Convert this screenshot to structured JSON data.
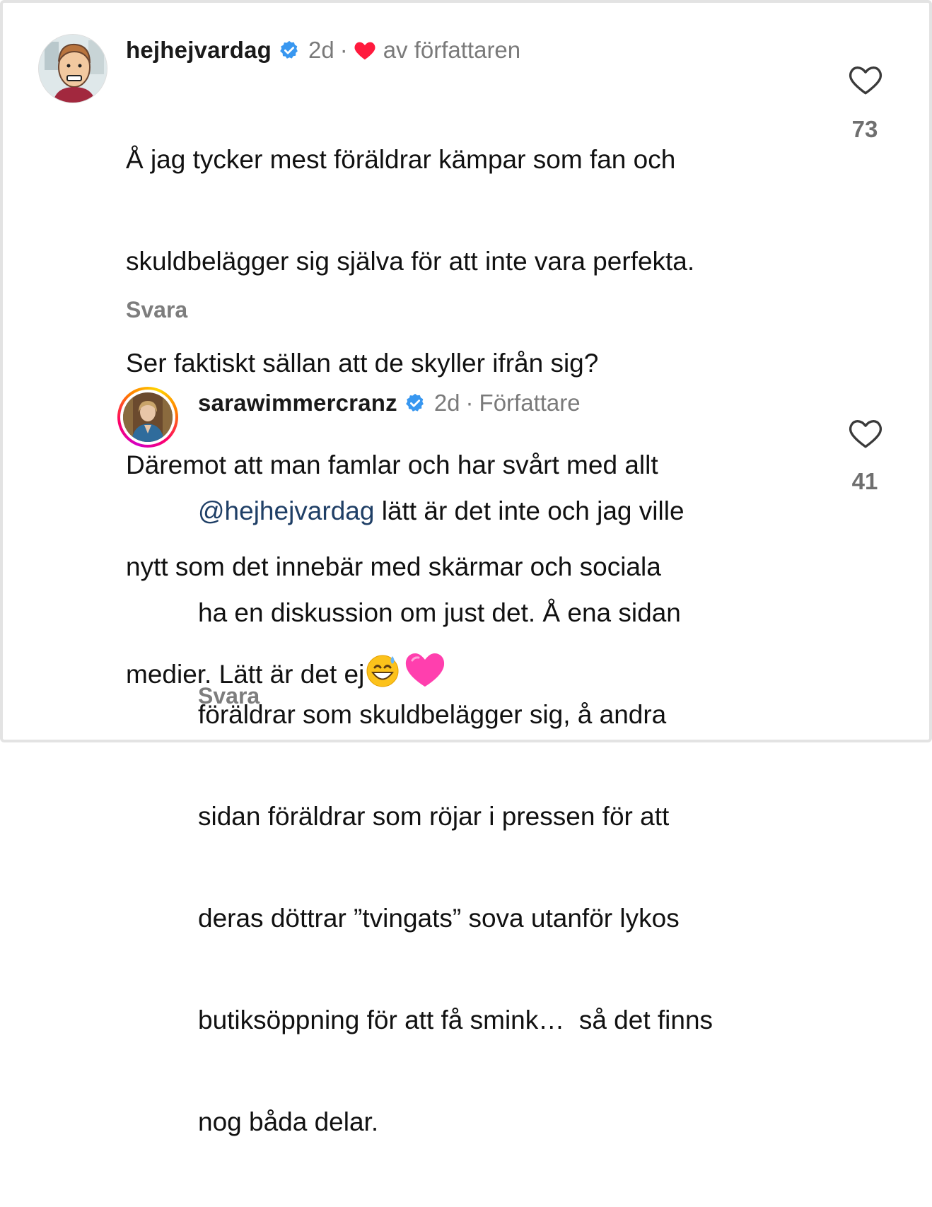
{
  "comments": [
    {
      "username": "hejhejvardag",
      "time": "2d",
      "separator": "·",
      "liked_by_author_label": "av författaren",
      "text_lines": [
        "Å jag tycker mest föräldrar kämpar som fan och",
        "skuldbelägger sig själva för att inte vara perfekta.",
        "Ser faktiskt sällan att de skyller ifrån sig?",
        "Däremot att man famlar och har svårt med allt",
        "nytt som det innebär med skärmar och sociala",
        "medier. Lätt är det ej"
      ],
      "emojis": [
        "grinning-sweat-emoji",
        "pink-heart-emoji"
      ],
      "reply_label": "Svara",
      "like_count": "73",
      "avatar": "cartoon-avatar"
    },
    {
      "username": "sarawimmercranz",
      "time": "2d",
      "separator": "·",
      "author_badge": "Författare",
      "mention": "@hejhejvardag",
      "text_lines": [
        " lätt är det inte och jag ville",
        "ha en diskussion om just det. Å ena sidan",
        "föräldrar som skuldbelägger sig, å andra",
        "sidan föräldrar som röjar i pressen för att",
        "deras döttrar ”tvingats” sova utanför lykos",
        "butiksöppning för att få smink…  så det finns",
        "nog båda delar."
      ],
      "reply_label": "Svara",
      "like_count": "41",
      "avatar": "photo-avatar-with-story-ring"
    }
  ],
  "colors": {
    "verified_blue": "#3897f0",
    "heart_red": "#ff1a3d",
    "mention_blue": "#1f3f66",
    "meta_gray": "#7a7a7a"
  }
}
